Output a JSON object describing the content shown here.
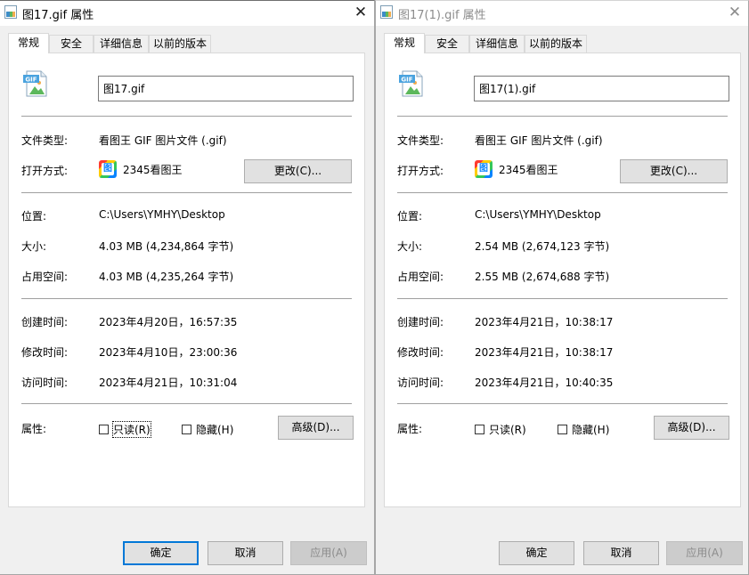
{
  "dialogs": [
    {
      "title": "图17.gif 属性",
      "close_glyph": "✕",
      "tabs": [
        "常规",
        "安全",
        "详细信息",
        "以前的版本"
      ],
      "file_icon_label": "GIF",
      "file_name": "图17.gif",
      "type_label": "文件类型:",
      "type_value": "看图王 GIF 图片文件 (.gif)",
      "open_label": "打开方式:",
      "open_value": "2345看图王",
      "change_button": "更改(C)...",
      "location_label": "位置:",
      "location_value": "C:\\Users\\YMHY\\Desktop",
      "size_label": "大小:",
      "size_value": "4.03 MB (4,234,864 字节)",
      "disk_label": "占用空间:",
      "disk_value": "4.03 MB (4,235,264 字节)",
      "created_label": "创建时间:",
      "created_value": "2023年4月20日，16:57:35",
      "modified_label": "修改时间:",
      "modified_value": "2023年4月10日，23:00:36",
      "accessed_label": "访问时间:",
      "accessed_value": "2023年4月21日，10:31:04",
      "attr_label": "属性:",
      "readonly_label": "只读(R)",
      "hidden_label": "隐藏(H)",
      "advanced_button": "高级(D)...",
      "ok_button": "确定",
      "cancel_button": "取消",
      "apply_button": "应用(A)"
    },
    {
      "title": "图17(1).gif 属性",
      "close_glyph": "✕",
      "tabs": [
        "常规",
        "安全",
        "详细信息",
        "以前的版本"
      ],
      "file_icon_label": "GIF",
      "file_name": "图17(1).gif",
      "type_label": "文件类型:",
      "type_value": "看图王 GIF 图片文件 (.gif)",
      "open_label": "打开方式:",
      "open_value": "2345看图王",
      "change_button": "更改(C)...",
      "location_label": "位置:",
      "location_value": "C:\\Users\\YMHY\\Desktop",
      "size_label": "大小:",
      "size_value": "2.54 MB (2,674,123 字节)",
      "disk_label": "占用空间:",
      "disk_value": "2.55 MB (2,674,688 字节)",
      "created_label": "创建时间:",
      "created_value": "2023年4月21日，10:38:17",
      "modified_label": "修改时间:",
      "modified_value": "2023年4月21日，10:38:17",
      "accessed_label": "访问时间:",
      "accessed_value": "2023年4月21日，10:40:35",
      "attr_label": "属性:",
      "readonly_label": "只读(R)",
      "hidden_label": "隐藏(H)",
      "advanced_button": "高级(D)...",
      "ok_button": "确定",
      "cancel_button": "取消",
      "apply_button": "应用(A)"
    }
  ],
  "colors": {
    "accent": "#0078d7",
    "panel_bg": "#ffffff",
    "dialog_bg": "#f0f0f0"
  },
  "icons": {
    "title": "gif-file-icon",
    "app": "2345-viewer-icon",
    "close": "close-icon"
  }
}
